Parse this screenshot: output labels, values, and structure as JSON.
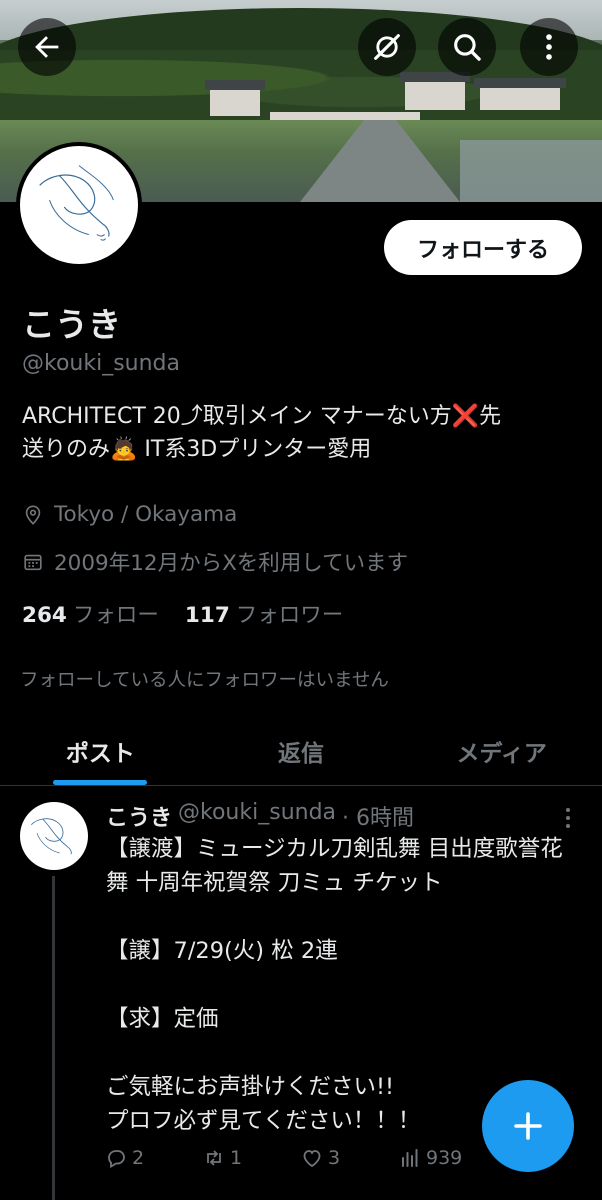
{
  "profile": {
    "name": "こうき",
    "handle": "@kouki_sunda",
    "bio_line1": "ARCHITECT 20⤴取引メイン マナーない方❌先",
    "bio_line2": "送りのみ🙇 IT系3Dプリンター愛用",
    "location": "Tokyo / Okayama",
    "joined": "2009年12月からXを利用しています",
    "following_count": "264",
    "following_label": "フォロー",
    "followers_count": "117",
    "followers_label": "フォロワー",
    "no_followers_you_know": "フォローしている人にフォロワーはいません",
    "follow_button": "フォローする"
  },
  "tabs": [
    {
      "label": "ポスト",
      "active": true
    },
    {
      "label": "返信",
      "active": false
    },
    {
      "label": "メディア",
      "active": false
    }
  ],
  "post": {
    "author_name": "こうき",
    "author_handle": "@kouki_sunda",
    "time": "· 6時間",
    "body": "【譲渡】ミュージカル刀剣乱舞 目出度歌誉花舞 十周年祝賀祭 刀ミュ チケット\n\n【譲】7/29(火) 松 2連\n\n【求】定価\n\nご気軽にお声掛けください!!\nプロフ必ず見てください！！！",
    "replies": "2",
    "reposts": "1",
    "likes": "3",
    "views": "939"
  },
  "icons": {
    "back": "arrow-left-icon",
    "grok": "grok-icon",
    "search": "search-icon",
    "more": "more-vertical-icon",
    "location": "location-pin-icon",
    "calendar": "calendar-icon",
    "compose": "plus-icon"
  },
  "colors": {
    "accent": "#1d9bf0",
    "background": "#000000",
    "text": "#e7e9ea",
    "muted": "#71767b"
  }
}
